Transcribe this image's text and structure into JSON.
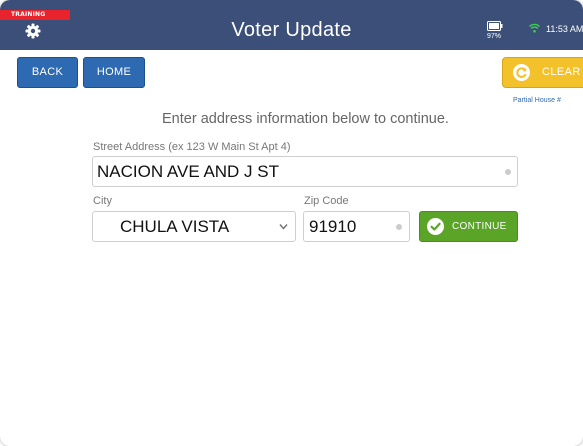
{
  "header": {
    "training_badge": "TRAINING",
    "title": "Voter Update",
    "battery_percent": "97%",
    "time": "11:53 AM",
    "icons": [
      "gear-icon",
      "battery-icon",
      "wifi-icon"
    ]
  },
  "toolbar": {
    "back_label": "BACK",
    "home_label": "HOME",
    "clear_label": "CLEAR",
    "partial_house_label": "Partial House #"
  },
  "form": {
    "instructions": "Enter address information below to continue.",
    "street_label": "Street Address (ex 123 W Main St Apt 4)",
    "street_value": "NACION AVE AND J ST",
    "city_label": "City",
    "city_value": "CHULA VISTA",
    "zip_label": "Zip Code",
    "zip_value": "91910",
    "continue_label": "CONTINUE"
  },
  "colors": {
    "header_bg": "#3b4f78",
    "training_red": "#e8232c",
    "nav_blue": "#2d6ab2",
    "clear_yellow": "#f3c12a",
    "continue_green": "#5aa428"
  }
}
